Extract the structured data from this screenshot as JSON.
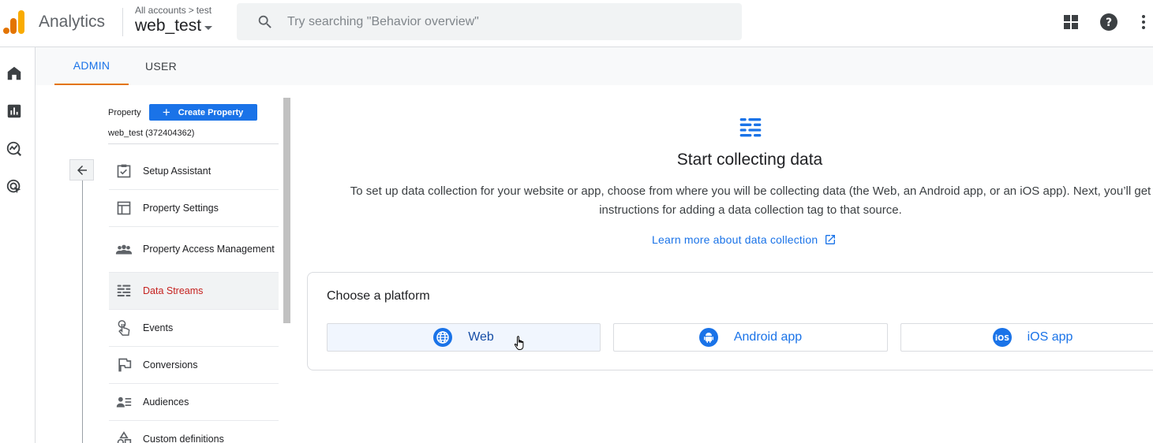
{
  "header": {
    "product_name": "Analytics",
    "breadcrumb_root": "All accounts",
    "breadcrumb_separator": ">",
    "breadcrumb_account": "test",
    "property_name": "web_test",
    "search_placeholder": "Try searching \"Behavior overview\"",
    "icons": [
      "apps-grid-icon",
      "help-icon",
      "more-vert-icon"
    ]
  },
  "rail": {
    "icons": [
      "home-icon",
      "reports-icon",
      "explore-icon",
      "advertising-icon"
    ]
  },
  "tabs": [
    {
      "label": "ADMIN",
      "active": true
    },
    {
      "label": "USER",
      "active": false
    }
  ],
  "admin_nav": {
    "property_label": "Property",
    "create_property_label": "Create Property",
    "property_id": "web_test (372404362)",
    "items": [
      {
        "label": "Setup Assistant",
        "icon": "checklist-icon"
      },
      {
        "label": "Property Settings",
        "icon": "property-settings-icon"
      },
      {
        "label": "Property Access Management",
        "icon": "people-icon"
      },
      {
        "label": "Data Streams",
        "icon": "data-streams-icon",
        "selected": true
      },
      {
        "label": "Events",
        "icon": "touch-icon"
      },
      {
        "label": "Conversions",
        "icon": "flag-icon"
      },
      {
        "label": "Audiences",
        "icon": "audiences-icon"
      },
      {
        "label": "Custom definitions",
        "icon": "shapes-icon"
      }
    ]
  },
  "main": {
    "title": "Start collecting data",
    "description": "To set up data collection for your website or app, choose from where you will be collecting data (the Web, an Android app, or an iOS app). Next, you’ll get instructions for adding a data collection tag to that source.",
    "learn_more": "Learn more about data collection",
    "card_title": "Choose a platform",
    "platforms": [
      {
        "label": "Web",
        "icon": "globe-icon"
      },
      {
        "label": "Android app",
        "icon": "android-icon"
      },
      {
        "label": "iOS app",
        "icon": "ios-icon"
      }
    ]
  },
  "colors": {
    "accent_blue": "#1a73e8",
    "tab_underline": "#e37400",
    "selected_text": "#c5221f",
    "logo_orange": "#f9ab00",
    "logo_dark_orange": "#e37400"
  }
}
